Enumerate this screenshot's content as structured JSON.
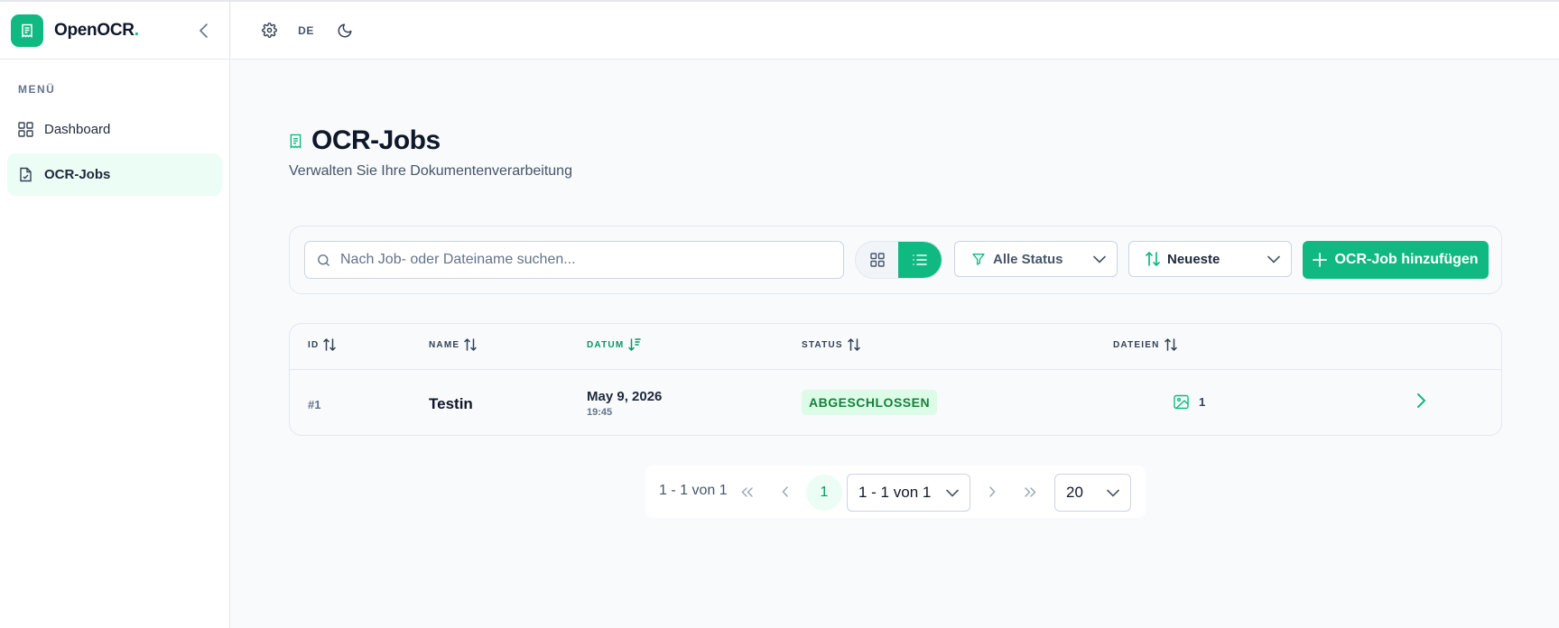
{
  "app": {
    "name": "OpenOCR",
    "name_dot": "."
  },
  "sidebar": {
    "menu_label": "MENÜ",
    "items": [
      {
        "label": "Dashboard",
        "icon": "grid-icon",
        "active": false
      },
      {
        "label": "OCR-Jobs",
        "icon": "file-icon",
        "active": true
      }
    ]
  },
  "header": {
    "language": "DE"
  },
  "page": {
    "title": "OCR-Jobs",
    "subtitle": "Verwalten Sie Ihre Dokumentenverarbeitung"
  },
  "toolbar": {
    "search_placeholder": "Nach Job- oder Dateiname suchen...",
    "status_filter": "Alle Status",
    "sort": "Neueste",
    "add_label": "OCR-Job hinzufügen"
  },
  "table": {
    "columns": [
      "ID",
      "NAME",
      "DATUM",
      "STATUS",
      "DATEIEN"
    ],
    "active_sort_column": "DATUM",
    "rows": [
      {
        "id": "#1",
        "name": "Testin",
        "date": "May 9, 2026",
        "time": "19:45",
        "status": "ABGESCHLOSSEN",
        "files": "1"
      }
    ]
  },
  "pagination": {
    "summary": "1 - 1 von 1",
    "current_page": "1",
    "range_select": "1 - 1 von 1",
    "page_size": "20"
  },
  "colors": {
    "accent": "#10b981",
    "accent_light": "#ecfdf5",
    "status_success_bg": "#dcfce7",
    "status_success_text": "#15803d"
  }
}
